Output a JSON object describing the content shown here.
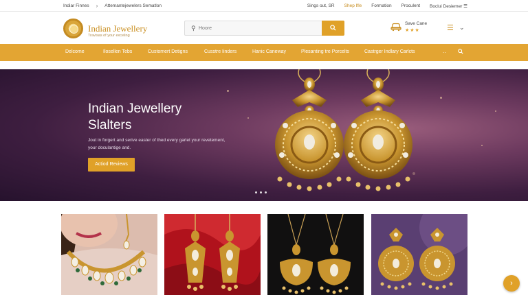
{
  "topbar": {
    "crumb_home": "Indiar Finnes",
    "crumb_current": "Attemantejewelers Sematlon",
    "links": [
      "Sings out, SR",
      "Shep Ifle",
      "Formation",
      "Proculent",
      "Boclui Desiemer"
    ],
    "highlight_index": 1
  },
  "header": {
    "brand": "Indian Jewellery",
    "tagline": "Travisas of your exceling",
    "search_placeholder": "Hoore",
    "save_title": "Save Cane",
    "rating_stars": "★★★",
    "menu_icon": "hamburger-icon",
    "chevron_icon": "chevron-down-icon"
  },
  "nav": {
    "items": [
      "Delcome",
      "Ilosellen Tebs",
      "Customert Detigns",
      "Cusstre Iinders",
      "Hanic Caneway",
      "Plesanting tre Porcelts",
      "Castrger Indlary Carlcts"
    ],
    "more": "..",
    "search_icon": "search-icon"
  },
  "hero": {
    "title_line1": "Indian Jewellery",
    "title_line2": "Slalters",
    "description": "Jout in forgert and serive easter of thed every garlet your revetement, your doculantige and.",
    "cta_label": "Actiod Reviews"
  },
  "colors": {
    "accent": "#e3a533",
    "brand": "#c98e1e",
    "hero_dark": "#3e1e40",
    "hero_light": "#9a5d7c"
  },
  "products": [
    {
      "icon": "necklace-model-image"
    },
    {
      "icon": "earrings-red-image"
    },
    {
      "icon": "earrings-black-image"
    },
    {
      "icon": "earrings-purple-image"
    }
  ]
}
